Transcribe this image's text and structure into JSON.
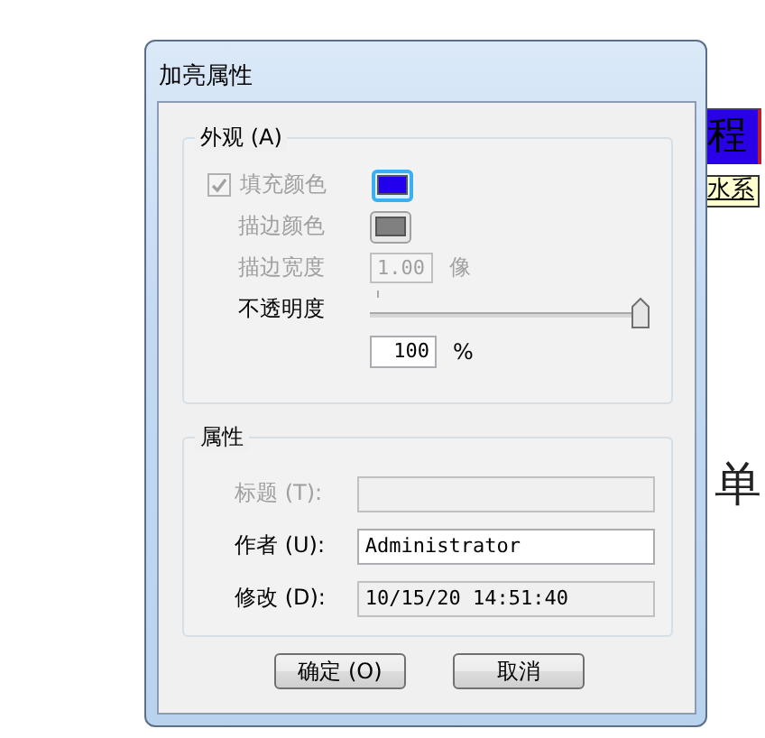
{
  "background": {
    "texts": [
      {
        "text": "程",
        "kind": "highlight"
      },
      {
        "text": "水系",
        "kind": "link"
      },
      {
        "text": "单",
        "kind": "large"
      }
    ]
  },
  "dialog": {
    "title": "加亮属性",
    "appearance": {
      "title": "外观 (A)",
      "fill": {
        "label": "填充颜色",
        "checked": true,
        "disabled": true,
        "color": "#2200ee"
      },
      "stroke": {
        "label": "描边颜色",
        "disabled": true,
        "color": "#808080"
      },
      "stroke_width": {
        "label": "描边宽度",
        "value": "1.00",
        "unit": "像",
        "disabled": true
      },
      "opacity": {
        "label": "不透明度",
        "level": 1.0,
        "value": "100",
        "unit": "%"
      }
    },
    "properties": {
      "title": "属性",
      "fields": [
        {
          "label": "标题 (T):",
          "disabled": true,
          "readonly": false
        },
        {
          "label": "作者 (U):",
          "value": "Administrator",
          "disabled": false,
          "readonly": false
        },
        {
          "label": "修改 (D):",
          "value": "10/15/20 14:51:40",
          "disabled": false,
          "readonly": true
        }
      ]
    },
    "buttons": [
      {
        "label": "确定 (O)"
      },
      {
        "label": "取消"
      }
    ]
  }
}
